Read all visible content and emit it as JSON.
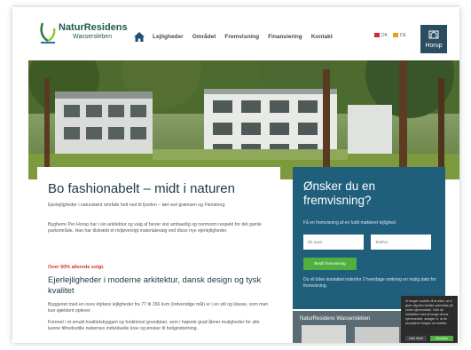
{
  "header": {
    "logo_name": "NaturResidens",
    "logo_sub": "Wassersleben",
    "nav": [
      "Lejligheder",
      "Området",
      "Fremvisning",
      "Finansiering",
      "Kontakt"
    ],
    "lang": [
      "DK",
      "DE"
    ],
    "badge": "Horup"
  },
  "content": {
    "title": "Bo fashionabelt – midt i naturen",
    "intro": "Ejerlejligheder i naturskønt område helt ned til fjorden – tæt ved grænsen og Flensborg",
    "body": "Bygherre Per Horup har i sin arkitektur og valg af farver vist ambaedig og normsom respekt for det gamle parkområde. Han har tilstræbt et miljøvenligt materialevalg ved disse nye ejerlejligheder.",
    "sold": "Over 50% allerede solgt.",
    "subtitle": "Ejerlejligheder i moderne arkitektur, dansk design og tysk kvalitet",
    "para2": "Byggeriet med en oves ètplans lejligheder fra 77 til 156 kvm (indvendige mål) er i en stil og klasse, som man kun sjældent oplever.",
    "para3": "Forenet i et smukt kvalitetsbyggeri og funktionel grundplan, som i højeste grad åbner muligheder for alle kunne tilfredsstille nabernes individuelle krav og ønsker til boligindretning."
  },
  "form": {
    "title": "Ønsker du en fremvisning?",
    "subtitle": "Få en fremvisning af en fuldt møbleret lejlighed",
    "name_placeholder": "Dit navn",
    "phone_placeholder": "Telefon",
    "submit": "Bestil fremvisning",
    "note": "Du vil blive kontaktet indenfor 2 hverdage omkring en mulig dato for fremvisning."
  },
  "thumb": {
    "label": "NaturResidens Wassersleben"
  },
  "cookie": {
    "text": "Vi bruger cookies til at sikre, at vi giver dig den bedste oplevelse på vores hjemmeside. Hvis du fortsætter med at bruge denne hjemmeside, antager vi, at du accepterer brugen af cookies.",
    "more": "Læs mere",
    "ok": "Accepter"
  },
  "colors": {
    "brand": "#1d5a4e",
    "panel": "#1f5f7c",
    "accent_green": "#4faf3f",
    "accent_red": "#d0312d"
  }
}
